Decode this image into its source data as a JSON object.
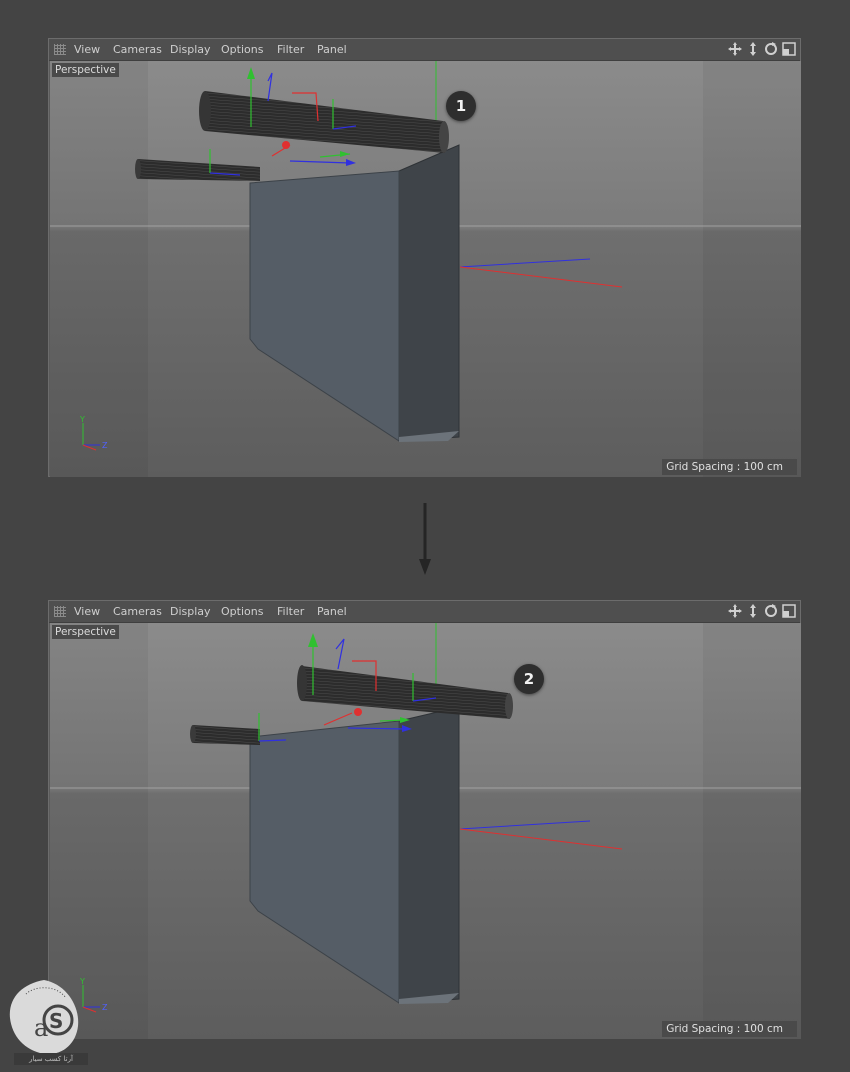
{
  "viewports": [
    {
      "menu": [
        "View",
        "Cameras",
        "Display",
        "Options",
        "Filter",
        "Panel"
      ],
      "camera_label": "Perspective",
      "grid_spacing": "Grid Spacing : 100 cm",
      "step_badge": "1",
      "axis_labels": {
        "y": "Y",
        "z": "Z"
      },
      "nav_icons": [
        "move-icon",
        "zoom-icon",
        "rotate-icon",
        "maximize-icon"
      ]
    },
    {
      "menu": [
        "View",
        "Cameras",
        "Display",
        "Options",
        "Filter",
        "Panel"
      ],
      "camera_label": "Perspective",
      "grid_spacing": "Grid Spacing : 100 cm",
      "step_badge": "2",
      "axis_labels": {
        "y": "Y",
        "z": "Z"
      },
      "nav_icons": [
        "move-icon",
        "zoom-icon",
        "rotate-icon",
        "maximize-icon"
      ]
    }
  ],
  "watermark": "آرتا کسب سیار",
  "colors": {
    "axis_x": "#e03030",
    "axis_y": "#30c030",
    "axis_z": "#3030e0",
    "background": "#444444"
  }
}
